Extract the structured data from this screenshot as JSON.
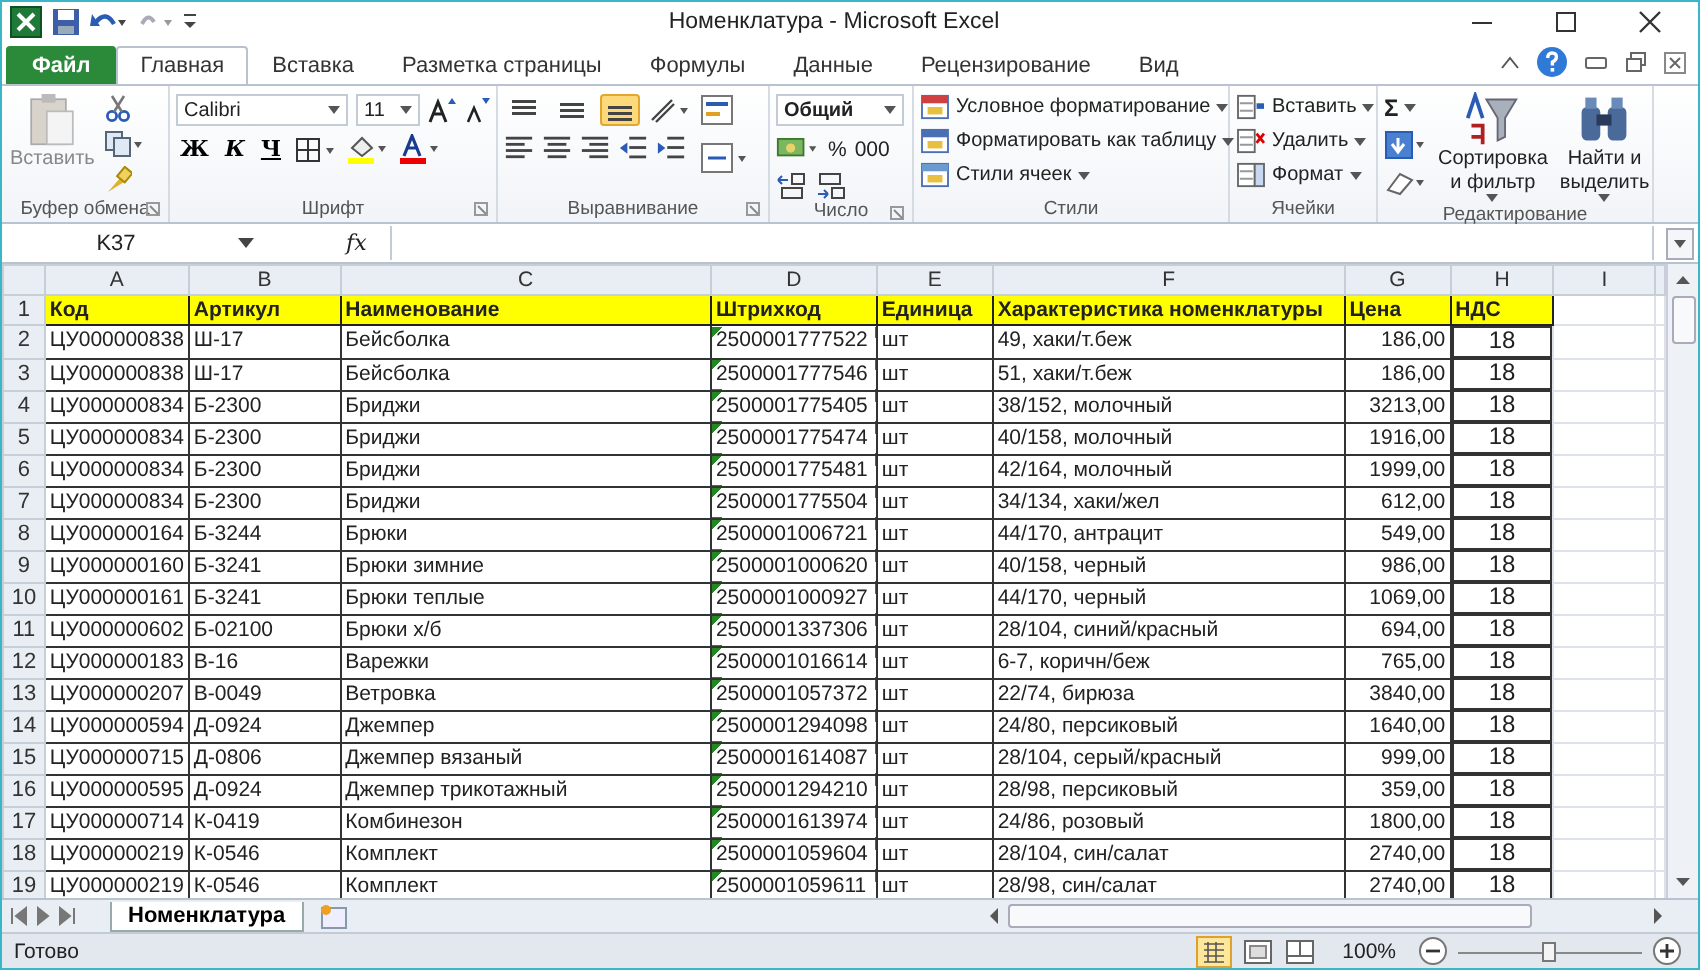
{
  "window": {
    "title": "Номенклатура - Microsoft Excel"
  },
  "tabs": [
    {
      "label": "Файл",
      "kind": "file",
      "selected": false
    },
    {
      "label": "Главная",
      "kind": "tab",
      "selected": true
    },
    {
      "label": "Вставка",
      "kind": "tab",
      "selected": false
    },
    {
      "label": "Разметка страницы",
      "kind": "tab",
      "selected": false
    },
    {
      "label": "Формулы",
      "kind": "tab",
      "selected": false
    },
    {
      "label": "Данные",
      "kind": "tab",
      "selected": false
    },
    {
      "label": "Рецензирование",
      "kind": "tab",
      "selected": false
    },
    {
      "label": "Вид",
      "kind": "tab",
      "selected": false
    }
  ],
  "ribbon": {
    "groups": [
      {
        "kind": "clipboard",
        "label": "Буфер обмена",
        "paste": "Вставить"
      },
      {
        "kind": "font",
        "label": "Шрифт",
        "font": "Calibri",
        "size": "11",
        "bold": "Ж",
        "italic": "К",
        "underline": "Ч"
      },
      {
        "kind": "alignment",
        "label": "Выравнивание",
        "vertical": [
          {
            "selected": false
          },
          {
            "selected": false
          },
          {
            "selected": true
          }
        ]
      },
      {
        "kind": "number",
        "label": "Число",
        "format": "Общий",
        "percent": "%",
        "thousands": "000"
      },
      {
        "kind": "styles",
        "label": "Стили",
        "items": [
          "Условное форматирование",
          "Форматировать как таблицу",
          "Стили ячеек"
        ]
      },
      {
        "kind": "cells",
        "label": "Ячейки",
        "items": [
          "Вставить",
          "Удалить",
          "Формат"
        ]
      },
      {
        "kind": "editing",
        "label": "Редактирование",
        "sum": "Σ",
        "sort": "Сортировка и фильтр",
        "find": "Найти и выделить"
      }
    ]
  },
  "formula_bar": {
    "name_box": "K37",
    "fx": "fx"
  },
  "sheet": {
    "columns": [
      {
        "letter": "A",
        "text_number_marks": false
      },
      {
        "letter": "B",
        "text_number_marks": false
      },
      {
        "letter": "C",
        "text_number_marks": false
      },
      {
        "letter": "D",
        "text_number_marks": true
      },
      {
        "letter": "E",
        "text_number_marks": false
      },
      {
        "letter": "F",
        "text_number_marks": false
      },
      {
        "letter": "G",
        "text_number_marks": false
      },
      {
        "letter": "H",
        "text_number_marks": false
      },
      {
        "letter": "I",
        "text_number_marks": false
      }
    ],
    "rows": [
      {
        "number": "1",
        "kind": "header",
        "cells": [
          "Код",
          "Артикул",
          "Наименование",
          "Штрихкод",
          "Единица",
          "Характеристика номенклатуры",
          "Цена",
          "НДС"
        ]
      },
      {
        "number": "2",
        "kind": "data",
        "cells": [
          "ЦУ000000838",
          "Ш-17",
          "Бейсболка",
          "2500001777522",
          "шт",
          "49, хаки/т.беж",
          "186,00",
          "18"
        ]
      },
      {
        "number": "3",
        "kind": "data",
        "cells": [
          "ЦУ000000838",
          "Ш-17",
          "Бейсболка",
          "2500001777546",
          "шт",
          "51, хаки/т.беж",
          "186,00",
          "18"
        ]
      },
      {
        "number": "4",
        "kind": "data",
        "cells": [
          "ЦУ000000834",
          "Б-2300",
          "Бриджи",
          "2500001775405",
          "шт",
          "38/152, молочный",
          "3213,00",
          "18"
        ]
      },
      {
        "number": "5",
        "kind": "data",
        "cells": [
          "ЦУ000000834",
          "Б-2300",
          "Бриджи",
          "2500001775474",
          "шт",
          "40/158, молочный",
          "1916,00",
          "18"
        ]
      },
      {
        "number": "6",
        "kind": "data",
        "cells": [
          "ЦУ000000834",
          "Б-2300",
          "Бриджи",
          "2500001775481",
          "шт",
          "42/164, молочный",
          "1999,00",
          "18"
        ]
      },
      {
        "number": "7",
        "kind": "data",
        "cells": [
          "ЦУ000000834",
          "Б-2300",
          "Бриджи",
          "2500001775504",
          "шт",
          "34/134, хаки/жел",
          "612,00",
          "18"
        ]
      },
      {
        "number": "8",
        "kind": "data",
        "cells": [
          "ЦУ000000164",
          "Б-3244",
          "Брюки",
          "2500001006721",
          "шт",
          "44/170, антрацит",
          "549,00",
          "18"
        ]
      },
      {
        "number": "9",
        "kind": "data",
        "cells": [
          "ЦУ000000160",
          "Б-3241",
          "Брюки зимние",
          "2500001000620",
          "шт",
          "40/158, черный",
          "986,00",
          "18"
        ]
      },
      {
        "number": "10",
        "kind": "data",
        "cells": [
          "ЦУ000000161",
          "Б-3241",
          "Брюки теплые",
          "2500001000927",
          "шт",
          "44/170, черный",
          "1069,00",
          "18"
        ]
      },
      {
        "number": "11",
        "kind": "data",
        "cells": [
          "ЦУ000000602",
          "Б-02100",
          "Брюки х/б",
          "2500001337306",
          "шт",
          "28/104, синий/красный",
          "694,00",
          "18"
        ]
      },
      {
        "number": "12",
        "kind": "data",
        "cells": [
          "ЦУ000000183",
          "В-16",
          "Варежки",
          "2500001016614",
          "шт",
          "6-7, коричн/беж",
          "765,00",
          "18"
        ]
      },
      {
        "number": "13",
        "kind": "data",
        "cells": [
          "ЦУ000000207",
          "В-0049",
          "Ветровка",
          "2500001057372",
          "шт",
          "22/74, бирюза",
          "3840,00",
          "18"
        ]
      },
      {
        "number": "14",
        "kind": "data",
        "cells": [
          "ЦУ000000594",
          "Д-0924",
          "Джемпер",
          "2500001294098",
          "шт",
          "24/80, персиковый",
          "1640,00",
          "18"
        ]
      },
      {
        "number": "15",
        "kind": "data",
        "cells": [
          "ЦУ000000715",
          "Д-0806",
          "Джемпер вязаный",
          "2500001614087",
          "шт",
          "28/104, серый/красный",
          "999,00",
          "18"
        ]
      },
      {
        "number": "16",
        "kind": "data",
        "cells": [
          "ЦУ000000595",
          "Д-0924",
          "Джемпер трикотажный",
          "2500001294210",
          "шт",
          "28/98, персиковый",
          "359,00",
          "18"
        ]
      },
      {
        "number": "17",
        "kind": "data",
        "cells": [
          "ЦУ000000714",
          "К-0419",
          "Комбинезон",
          "2500001613974",
          "шт",
          "24/86, розовый",
          "1800,00",
          "18"
        ]
      },
      {
        "number": "18",
        "kind": "data",
        "cells": [
          "ЦУ000000219",
          "К-0546",
          "Комплект",
          "2500001059604",
          "шт",
          "28/104, син/салат",
          "2740,00",
          "18"
        ]
      },
      {
        "number": "19",
        "kind": "data",
        "cells": [
          "ЦУ000000219",
          "К-0546",
          "Комплект",
          "2500001059611",
          "шт",
          "28/98, син/салат",
          "2740,00",
          "18"
        ]
      }
    ]
  },
  "sheet_tabs": [
    {
      "label": "Номенклатура",
      "selected": true
    }
  ],
  "status_bar": {
    "status": "Готово",
    "zoom": "100%",
    "zoom_slider": {
      "level": 0.5
    }
  }
}
